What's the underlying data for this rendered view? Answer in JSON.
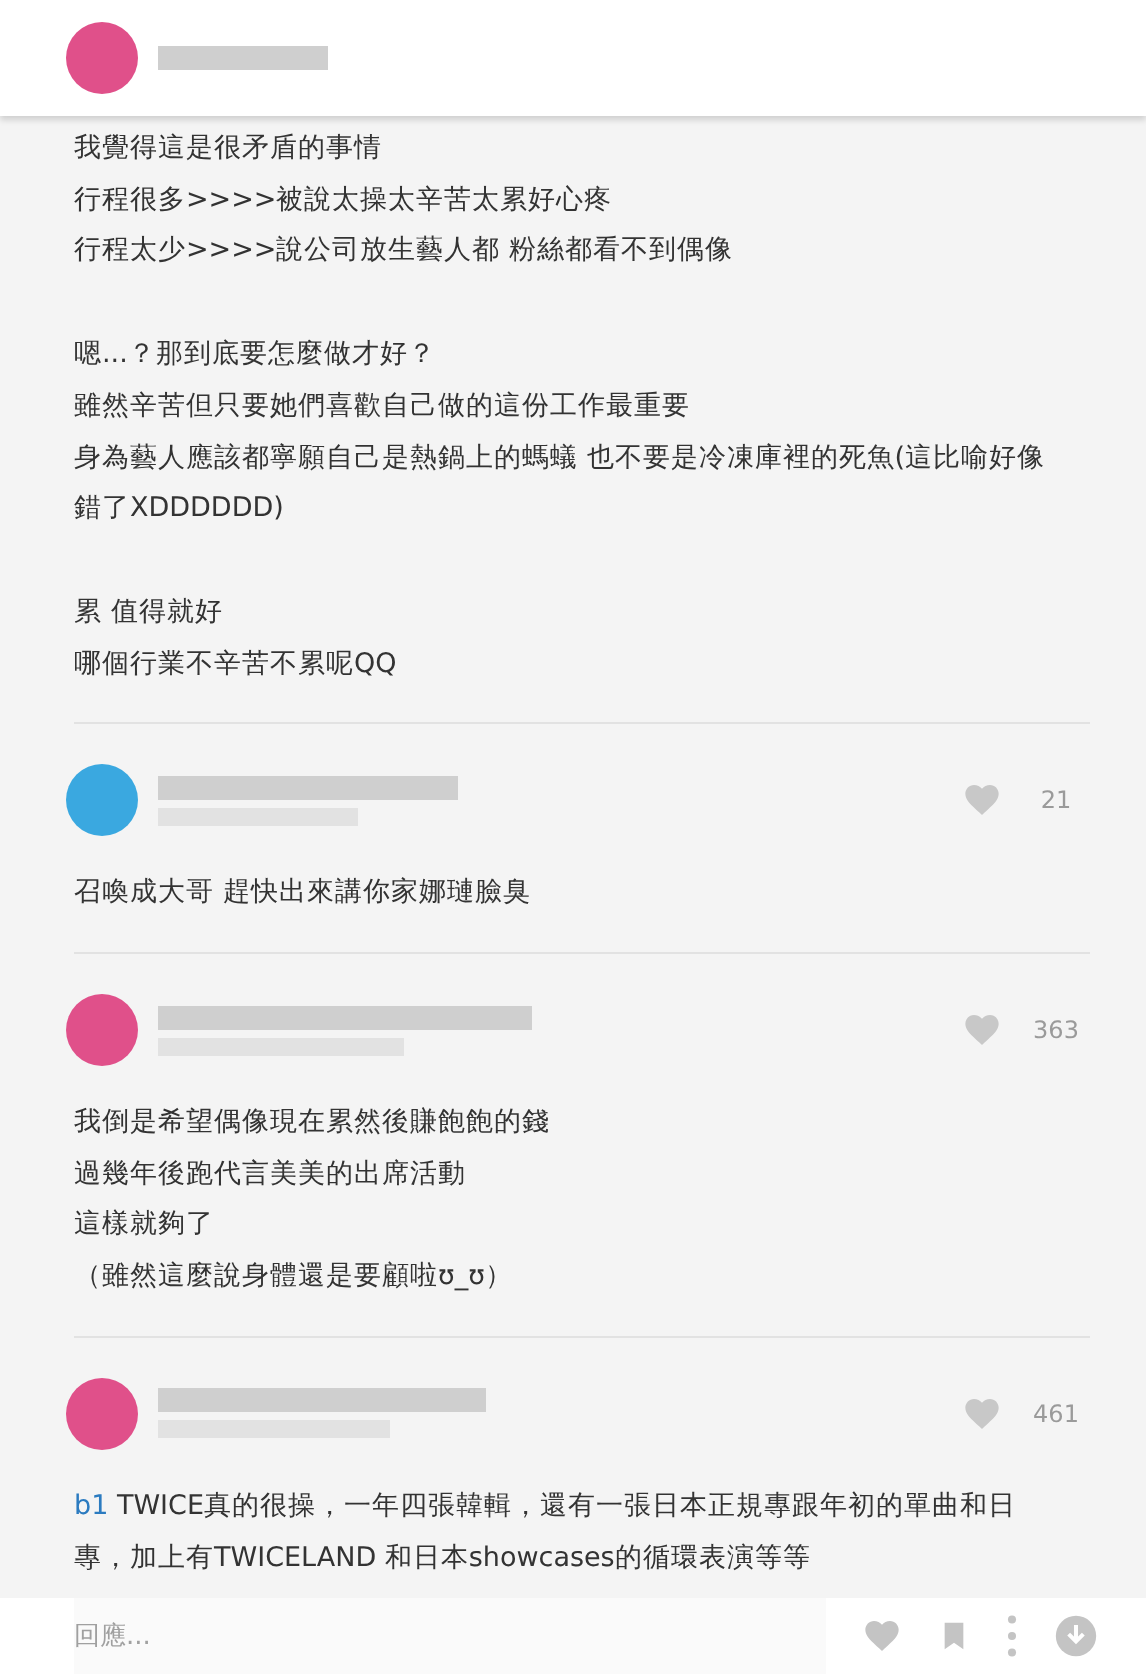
{
  "post": {
    "color": "#e0508a",
    "paragraphs": [
      [
        "我覺得這是很矛盾的事情",
        "行程很多>>>>被說太操太辛苦太累好心疼",
        "行程太少>>>>說公司放生藝人都 粉絲都看不到偶像"
      ],
      [
        "嗯...？那到底要怎麼做才好？",
        "雖然辛苦但只要她們喜歡自己做的這份工作最重要",
        "身為藝人應該都寧願自己是熱鍋上的螞蟻 也不要是冷凍庫裡的死魚(這比喻好像錯了XDDDDDD)"
      ],
      [
        "累 值得就好",
        "哪個行業不辛苦不累呢QQ"
      ]
    ]
  },
  "comments": [
    {
      "color": "#3aa8e0",
      "likes": "21",
      "paragraphs": [
        [
          "召喚成大哥 趕快出來講你家娜璉臉臭"
        ]
      ]
    },
    {
      "color": "#e0508a",
      "likes": "363",
      "paragraphs": [
        [
          "我倒是希望偶像現在累然後賺飽飽的錢",
          "過幾年後跑代言美美的出席活動",
          "這樣就夠了",
          "（雖然這麼說身體還是要顧啦ʊ_ʊ）"
        ]
      ]
    },
    {
      "color": "#e0508a",
      "likes": "461",
      "reply_to": "b1",
      "paragraphs": [
        [
          "TWICE真的很操，一年四張韓輯，還有一張日本正規專跟年初的單曲和日專，加上有TWICELAND 和日本showcases的循環表演等等"
        ]
      ]
    }
  ],
  "reply_bar": {
    "placeholder": "回應..."
  }
}
